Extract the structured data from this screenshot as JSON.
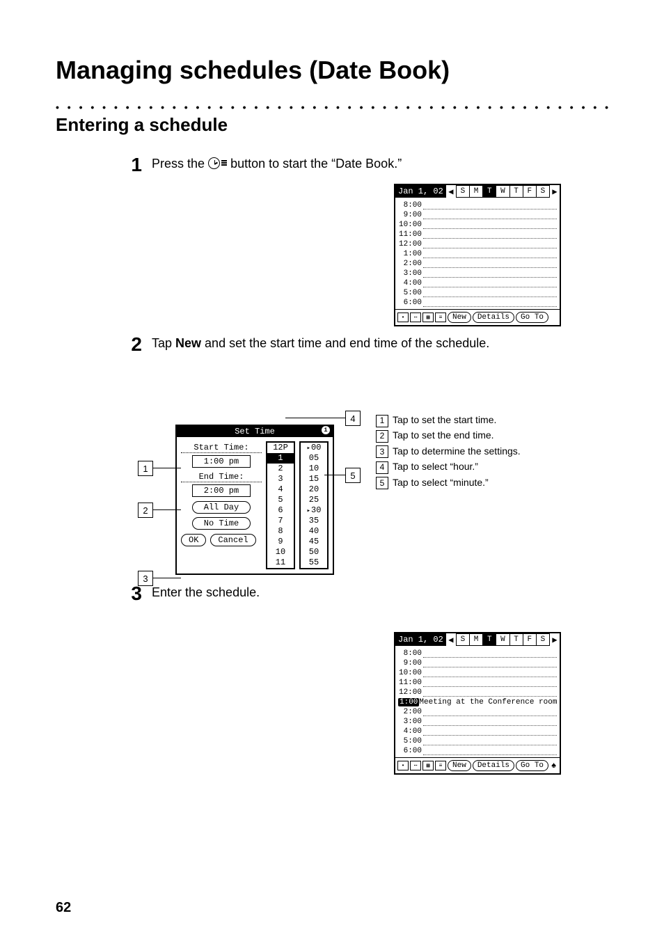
{
  "title": "Managing schedules (Date Book)",
  "subtitle": "Entering a schedule",
  "page_number": "62",
  "steps": {
    "s1": {
      "num": "1",
      "pre": "Press the ",
      "post": " button to start the “Date Book.”"
    },
    "s2": {
      "num": "2",
      "pre": "Tap ",
      "bold": "New",
      "post": " and set the start time and end time of the schedule."
    },
    "s3": {
      "num": "3",
      "text": "Enter the schedule."
    }
  },
  "pda": {
    "date": "Jan 1, 02",
    "days": [
      "S",
      "M",
      "T",
      "W",
      "T",
      "F",
      "S"
    ],
    "hours": [
      "8:00",
      "9:00",
      "10:00",
      "11:00",
      "12:00",
      "1:00",
      "2:00",
      "3:00",
      "4:00",
      "5:00",
      "6:00"
    ],
    "buttons": {
      "new": "New",
      "details": "Details",
      "goto": "Go To"
    },
    "entry_time": "1:00",
    "entry_text": "Meeting at the Conference room"
  },
  "settime": {
    "title": "Set Time",
    "start_label": "Start Time:",
    "start_value": "1:00 pm",
    "end_label": "End Time:",
    "end_value": "2:00 pm",
    "all_day": "All Day",
    "no_time": "No Time",
    "ok": "OK",
    "cancel": "Cancel",
    "hours": [
      "12P",
      "1",
      "2",
      "3",
      "4",
      "5",
      "6",
      "7",
      "8",
      "9",
      "10",
      "11"
    ],
    "minutes": [
      "00",
      "05",
      "10",
      "15",
      "20",
      "25",
      "30",
      "35",
      "40",
      "45",
      "50",
      "55"
    ]
  },
  "callouts": {
    "c1": "Tap to set the start time.",
    "c2": "Tap to set the end time.",
    "c3": "Tap to determine the settings.",
    "c4": "Tap to select “hour.”",
    "c5": "Tap to select “minute.”"
  },
  "labels": {
    "l1": "1",
    "l2": "2",
    "l3": "3",
    "l4": "4",
    "l5": "5"
  }
}
